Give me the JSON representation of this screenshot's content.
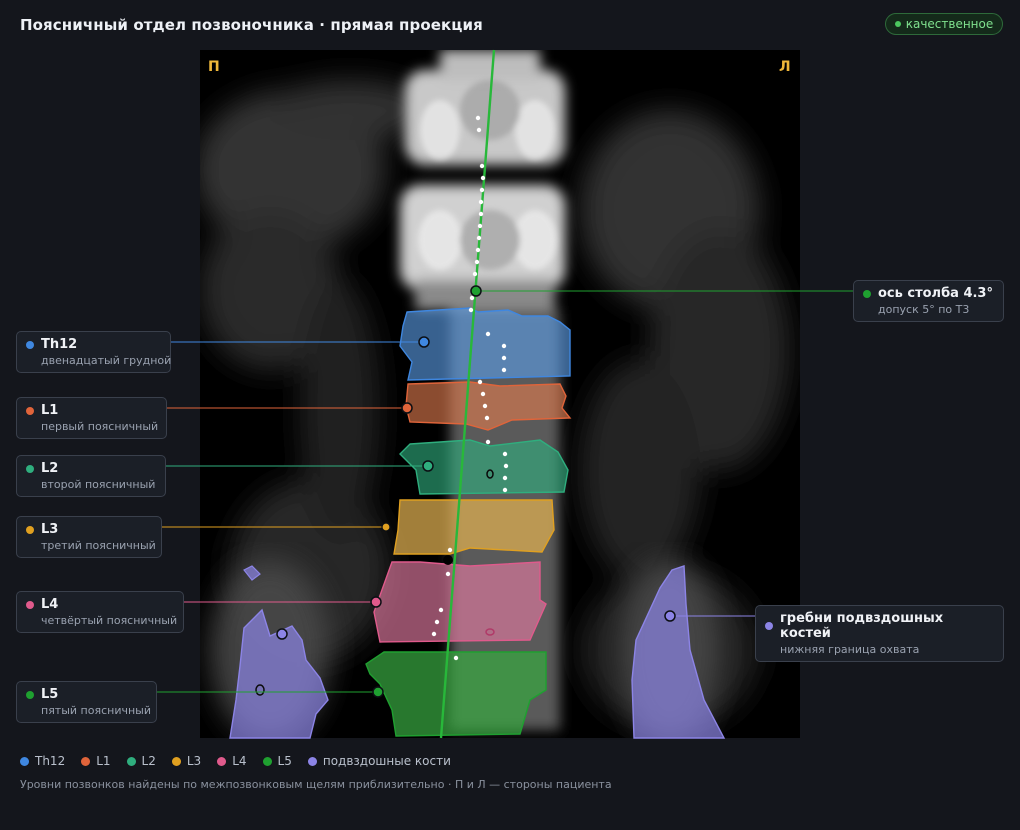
{
  "header": {
    "title": "Поясничный отдел позвоночника · прямая проекция",
    "quality_badge": "качественное"
  },
  "image": {
    "side_right": "П",
    "side_left": "Л"
  },
  "vertebrae": [
    {
      "id": "th12",
      "label": "Th12",
      "description": "двенадцатый грудной",
      "color": "#3f87e0"
    },
    {
      "id": "l1",
      "label": "L1",
      "description": "первый поясничный",
      "color": "#e0643a"
    },
    {
      "id": "l2",
      "label": "L2",
      "description": "второй поясничный",
      "color": "#2fae7e"
    },
    {
      "id": "l3",
      "label": "L3",
      "description": "третий поясничный",
      "color": "#e0a020"
    },
    {
      "id": "l4",
      "label": "L4",
      "description": "четвёртый поясничный",
      "color": "#e05a8c"
    },
    {
      "id": "l5",
      "label": "L5",
      "description": "пятый поясничный",
      "color": "#1fa030"
    }
  ],
  "axis": {
    "label": "ось столба 4.3°",
    "description": "допуск 5° по Т3",
    "color": "#1fa030",
    "angle_deg": 4.3
  },
  "iliac": {
    "label": "гребни подвздошных костей",
    "description": "нижняя граница охвата",
    "color": "#8c84e6"
  },
  "legend": [
    {
      "label": "Th12",
      "color": "#3f87e0"
    },
    {
      "label": "L1",
      "color": "#e0643a"
    },
    {
      "label": "L2",
      "color": "#2fae7e"
    },
    {
      "label": "L3",
      "color": "#e0a020"
    },
    {
      "label": "L4",
      "color": "#e05a8c"
    },
    {
      "label": "L5",
      "color": "#1fa030"
    },
    {
      "label": "подвздошные кости",
      "color": "#8c84e6"
    }
  ],
  "footnote": "Уровни позвонков найдены по межпозвонковым щелям приблизительно · П и Л — стороны пациента"
}
